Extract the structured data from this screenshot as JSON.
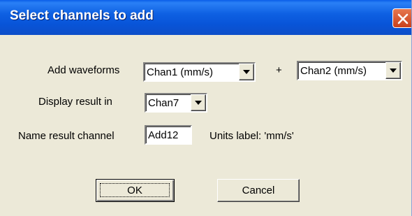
{
  "dialog": {
    "title": "Select channels to add",
    "close_icon": "close-icon"
  },
  "form": {
    "add_waveforms_label": "Add waveforms",
    "waveform1_value": "Chan1 (mm/s)",
    "plus_label": "+",
    "waveform2_value": "Chan2 (mm/s)",
    "display_result_label": "Display result in",
    "display_channel_value": "Chan7",
    "name_result_label": "Name result channel",
    "name_result_value": "Add12",
    "units_label": "Units label:  'mm/s'"
  },
  "buttons": {
    "ok_label": "OK",
    "cancel_label": "Cancel"
  },
  "colors": {
    "title_bar": "#0a5ee8",
    "dialog_bg": "#ece9d8",
    "close_button": "#d65b32"
  }
}
